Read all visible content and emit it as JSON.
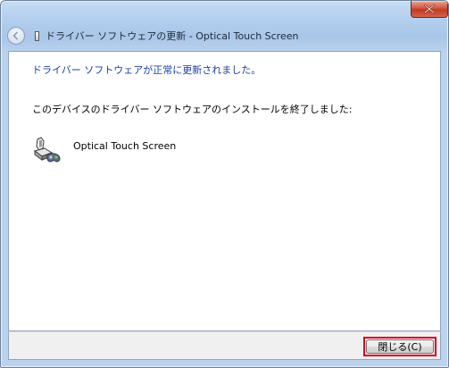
{
  "window": {
    "title": "ドライバー ソフトウェアの更新 - Optical Touch Screen",
    "close_glyph": "✕"
  },
  "content": {
    "success_message": "ドライバー ソフトウェアが正常に更新されました。",
    "info_message": "このデバイスのドライバー ソフトウェアのインストールを終了しました:",
    "device_name": "Optical Touch Screen"
  },
  "footer": {
    "close_button_label": "閉じる(C)"
  },
  "colors": {
    "success_text": "#1a3ea7",
    "highlight_border": "#d6001c",
    "title_close": "#c33a22"
  }
}
